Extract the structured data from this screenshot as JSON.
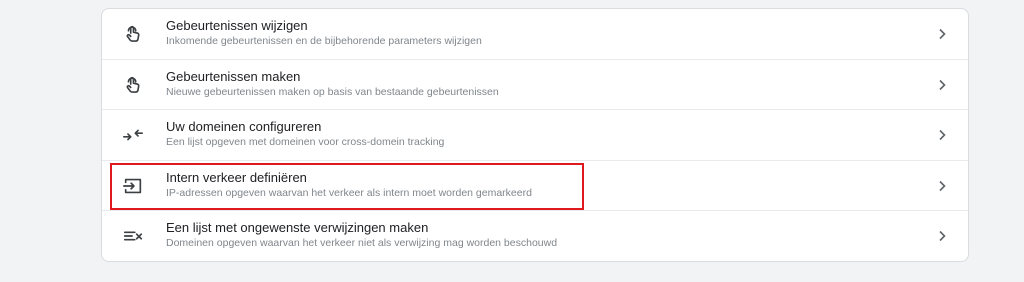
{
  "settings_list": {
    "items": [
      {
        "icon": "touch-gesture-icon",
        "title": "Gebeurtenissen wijzigen",
        "subtitle": "Inkomende gebeurtenissen en de bijbehorende parameters wijzigen"
      },
      {
        "icon": "touch-gesture-icon",
        "title": "Gebeurtenissen maken",
        "subtitle": "Nieuwe gebeurtenissen maken op basis van bestaande gebeurtenissen"
      },
      {
        "icon": "cross-domain-arrows-icon",
        "title": "Uw domeinen configureren",
        "subtitle": "Een lijst opgeven met domeinen voor cross-domein tracking"
      },
      {
        "icon": "login-box-icon",
        "title": "Intern verkeer definiëren",
        "subtitle": "IP-adressen opgeven waarvan het verkeer als intern moet worden gemarkeerd"
      },
      {
        "icon": "exclusion-list-icon",
        "title": "Een lijst met ongewenste verwijzingen maken",
        "subtitle": "Domeinen opgeven waarvan het verkeer niet als verwijzing mag worden beschouwd"
      }
    ]
  },
  "colors": {
    "background": "#f1f3f4",
    "panel": "#ffffff",
    "title": "#202124",
    "subtitle": "#80868b",
    "icon": "#3c4043",
    "highlight": "#e0191f"
  }
}
